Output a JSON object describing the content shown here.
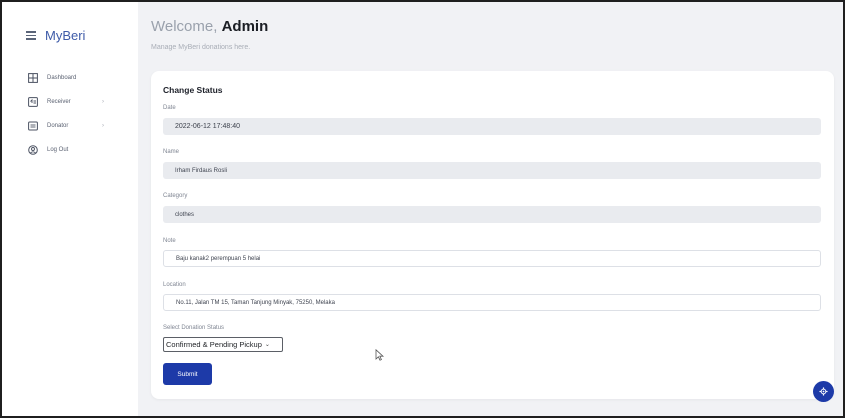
{
  "sidebar": {
    "brand": "MyBeri",
    "items": [
      {
        "label": "Dashboard",
        "icon": "grid-icon",
        "chevron": ""
      },
      {
        "label": "Receiver",
        "icon": "receiver-icon",
        "chevron": "›"
      },
      {
        "label": "Donator",
        "icon": "donator-icon",
        "chevron": "›"
      },
      {
        "label": "Log Out",
        "icon": "user-circle-icon",
        "chevron": ""
      }
    ]
  },
  "header": {
    "welcome": "Welcome,",
    "user": "Admin",
    "subtitle": "Manage MyBeri donations here."
  },
  "form": {
    "title": "Change Status",
    "date_label": "Date",
    "date_value": "2022-06-12 17:48:40",
    "name_label": "Name",
    "name_value": "Irham Firdaus Rosli",
    "category_label": "Category",
    "category_value": "clothes",
    "note_label": "Note",
    "note_value": "Baju kanak2 perempuan 5 helai",
    "location_label": "Location",
    "location_value": "No.11, Jalan TM 15, Taman Tanjung Minyak, 75250, Melaka",
    "status_label": "Select Donation Status",
    "status_value": "Confirmed & Pending Pickup",
    "submit_label": "Submit"
  },
  "colors": {
    "accent": "#1d3aa8",
    "brand_text": "#3e5ba8",
    "background": "#f1f2f5"
  }
}
